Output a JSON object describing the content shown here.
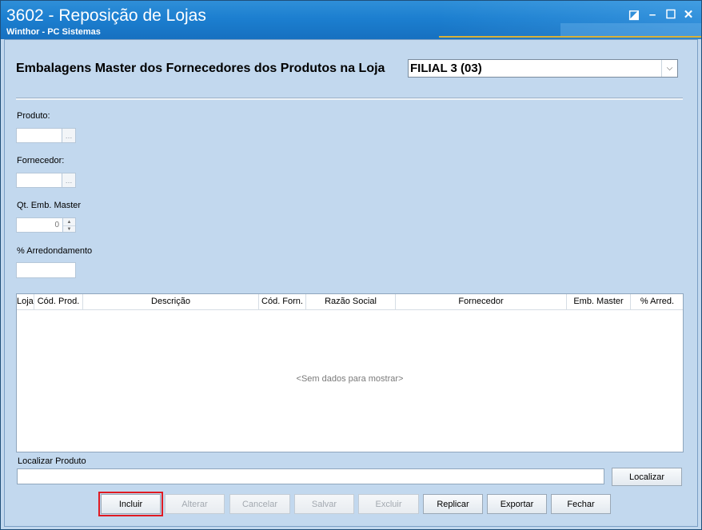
{
  "window": {
    "title": "3602 - Reposição de Lojas",
    "subtitle": "Winthor - PC Sistemas",
    "buttons": {
      "restore_icon": "◪",
      "minimize_icon": "–",
      "maximize_icon": "☐",
      "close_icon": "✕"
    }
  },
  "header": {
    "title": "Embalagens Master dos Fornecedores dos Produtos na Loja",
    "filial_value": "FILIAL 3 (03)"
  },
  "form": {
    "produto_label": "Produto:",
    "fornecedor_label": "Fornecedor:",
    "qt_emb_label": "Qt. Emb. Master",
    "qt_emb_value": "0",
    "arredondamento_label": "% Arredondamento",
    "ellipsis": "…"
  },
  "grid": {
    "columns": [
      "Loja",
      "Cód. Prod.",
      "Descrição",
      "Cód. Forn.",
      "Razão Social",
      "Fornecedor",
      "Emb. Master",
      "% Arred."
    ],
    "empty_message": "<Sem dados para mostrar>"
  },
  "search": {
    "label": "Localizar Produto",
    "value": "",
    "button": "Localizar"
  },
  "actions": {
    "incluir": "Incluir",
    "alterar": "Alterar",
    "cancelar": "Cancelar",
    "salvar": "Salvar",
    "excluir": "Excluir",
    "replicar": "Replicar",
    "exportar": "Exportar",
    "fechar": "Fechar"
  },
  "colors": {
    "titlebar": "#1c7fd0",
    "background": "#c2d8ee",
    "highlight": "#e01a22"
  }
}
